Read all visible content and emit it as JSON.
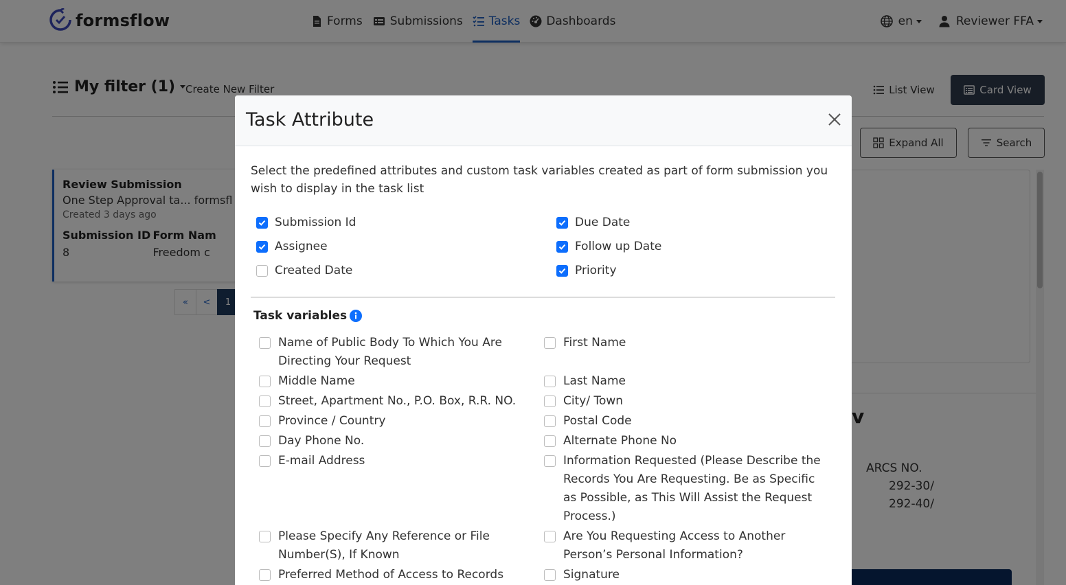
{
  "brand": "formsflow",
  "nav": {
    "forms": "Forms",
    "submissions": "Submissions",
    "tasks": "Tasks",
    "dashboards": "Dashboards",
    "language": "en",
    "user": "Reviewer FFA"
  },
  "toolbar": {
    "filter_name": "My filter (1)",
    "create_filter": "Create New Filter",
    "list_view": "List View",
    "card_view": "Card View",
    "expand_all": "Expand All",
    "search": "Search"
  },
  "task_card": {
    "title": "Review Submission",
    "subtitle": "One Step Approval ta...  formsfl",
    "created": "Created 3 days ago",
    "submission_id_label": "Submission ID",
    "submission_id_value": "8",
    "form_name_label": "Form Nam",
    "form_name_value": "Freedom c"
  },
  "pagination": {
    "first": "«",
    "prev": "<",
    "current": "1"
  },
  "details": {
    "letter": "v",
    "arcs_label": "ARCS NO.",
    "arcs_values": [
      "292-30/",
      "292-40/"
    ]
  },
  "modal": {
    "title": "Task Attribute",
    "description": "Select the predefined attributes and custom task variables created as part of form submission you wish to display in the task list",
    "attributes": [
      {
        "label": "Submission Id",
        "checked": true
      },
      {
        "label": "Due Date",
        "checked": true
      },
      {
        "label": "Assignee",
        "checked": true
      },
      {
        "label": "Follow up Date",
        "checked": true
      },
      {
        "label": "Created Date",
        "checked": false
      },
      {
        "label": "Priority",
        "checked": true
      }
    ],
    "task_variables_title": "Task variables",
    "variables": [
      {
        "label": "Name of Public Body To Which You Are Directing Your Request",
        "checked": false
      },
      {
        "label": "First Name",
        "checked": false
      },
      {
        "label": "Middle Name",
        "checked": false
      },
      {
        "label": "Last Name",
        "checked": false
      },
      {
        "label": "Street, Apartment No., P.O. Box, R.R. NO.",
        "checked": false
      },
      {
        "label": "City/ Town",
        "checked": false
      },
      {
        "label": "Province / Country",
        "checked": false
      },
      {
        "label": "Postal Code",
        "checked": false
      },
      {
        "label": "Day Phone No.",
        "checked": false
      },
      {
        "label": "Alternate Phone No",
        "checked": false
      },
      {
        "label": "E-mail Address",
        "checked": false
      },
      {
        "label": "Information Requested (Please Describe the Records You Are Requesting. Be as Specific as Possible, as This Will Assist the Request Process.)",
        "checked": false
      },
      {
        "label": "Please Specify Any Reference or File Number(S), If Known",
        "checked": false
      },
      {
        "label": "Are You Requesting Access to Another Person’s Personal Information?",
        "checked": false
      },
      {
        "label": "Preferred Method of Access to Records",
        "checked": false
      },
      {
        "label": "Signature",
        "checked": false
      }
    ]
  },
  "colors": {
    "accent": "#1b5cc0",
    "checkbox": "#0d6efd",
    "card_button": "#2f3b4c"
  }
}
